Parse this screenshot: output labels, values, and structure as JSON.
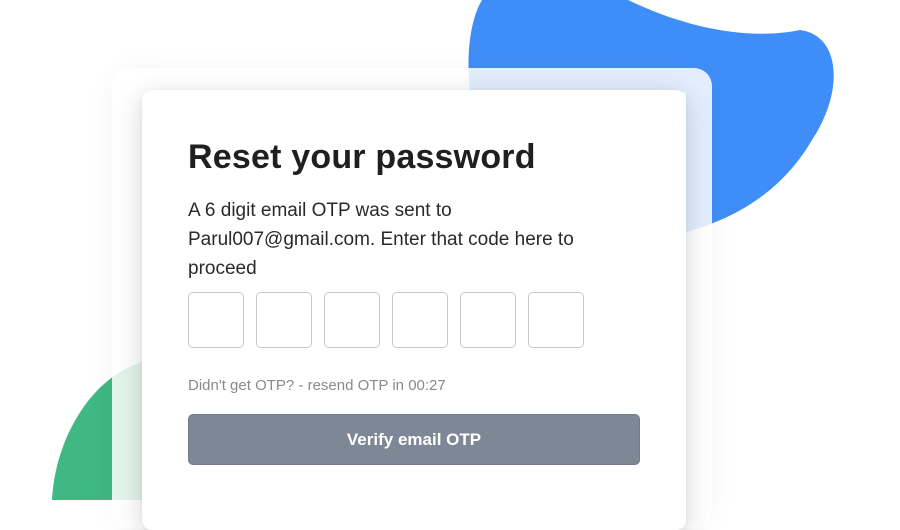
{
  "colors": {
    "blob_blue": "#3f8ef8",
    "blob_green": "#3fb883",
    "button_bg": "#7e8795",
    "text_muted": "#8a8a8a"
  },
  "card": {
    "title": "Reset your password",
    "description_line1": "A 6 digit email OTP was sent to",
    "email": "Parul007@gmail.com",
    "description_line2": ". Enter that code here to proceed"
  },
  "otp": {
    "digits": [
      "",
      "",
      "",
      "",
      "",
      ""
    ]
  },
  "resend": {
    "prefix": "Didn't get OTP? - resend OTP in",
    "timer": "00:27"
  },
  "verify_button": {
    "label": "Verify email OTP"
  }
}
